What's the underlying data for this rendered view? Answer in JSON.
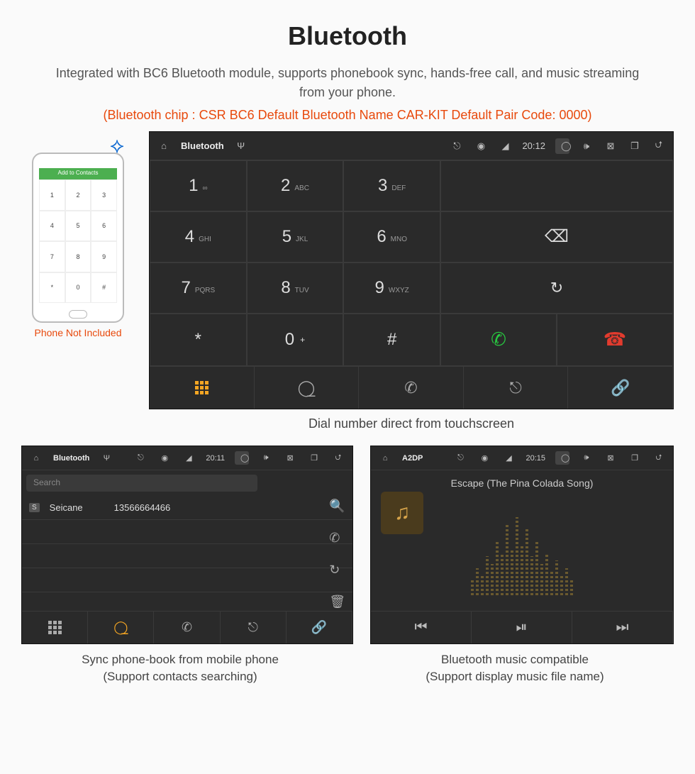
{
  "header": {
    "title": "Bluetooth",
    "subtitle": "Integrated with BC6 Bluetooth module, supports phonebook sync, hands-free call, and music streaming from your phone.",
    "specs": "(Bluetooth chip : CSR BC6    Default Bluetooth Name CAR-KIT    Default Pair Code: 0000)"
  },
  "phone_mock": {
    "bar_label": "Add to Contacts",
    "not_included": "Phone Not Included"
  },
  "dialer_screen": {
    "status": {
      "title": "Bluetooth",
      "time": "20:12"
    },
    "keys": [
      {
        "d": "1",
        "s": "∞"
      },
      {
        "d": "2",
        "s": "ABC"
      },
      {
        "d": "3",
        "s": "DEF"
      },
      {
        "d": "4",
        "s": "GHI"
      },
      {
        "d": "5",
        "s": "JKL"
      },
      {
        "d": "6",
        "s": "MNO"
      },
      {
        "d": "7",
        "s": "PQRS"
      },
      {
        "d": "8",
        "s": "TUV"
      },
      {
        "d": "9",
        "s": "WXYZ"
      },
      {
        "d": "*",
        "s": ""
      },
      {
        "d": "0",
        "s": "+",
        "sup": true
      },
      {
        "d": "#",
        "s": ""
      }
    ],
    "caption": "Dial number direct from touchscreen"
  },
  "phonebook_screen": {
    "status": {
      "title": "Bluetooth",
      "time": "20:11"
    },
    "search_placeholder": "Search",
    "contact": {
      "name": "Seicane",
      "number": "13566664466",
      "tag": "S"
    },
    "caption_l1": "Sync phone-book from mobile phone",
    "caption_l2": "(Support contacts searching)"
  },
  "music_screen": {
    "status": {
      "title": "A2DP",
      "time": "20:15"
    },
    "track": "Escape (The Pina Colada Song)",
    "caption_l1": "Bluetooth music compatible",
    "caption_l2": "(Support display music file name)"
  }
}
